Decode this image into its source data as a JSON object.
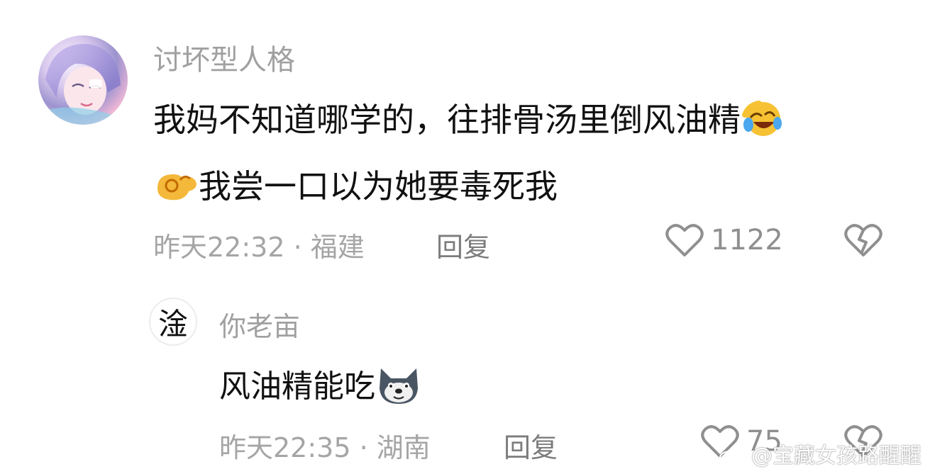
{
  "comments": [
    {
      "username": "讨坏型人格",
      "line1": "我妈不知道哪学的，往排骨汤里倒风油精",
      "line2": "我尝一口以为她要毒死我",
      "meta": "昨天22:32 · 福建",
      "reply": "回复",
      "likes": "1122"
    },
    {
      "avatar_char": "淦",
      "username": "你老亩",
      "text": "风油精能吃",
      "meta": "昨天22:35 · 湖南",
      "reply": "回复",
      "likes": "75"
    }
  ],
  "watermark": "@宝藏女孩路醒醒",
  "colors": {
    "text": "#111111",
    "username": "#a0a0a0",
    "meta": "#a5a5a5",
    "icon": "#8f8f8f"
  }
}
